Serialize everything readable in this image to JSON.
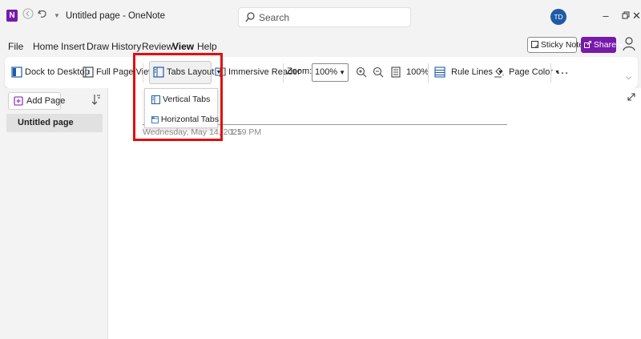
{
  "titlebar": {
    "app_logo": "N",
    "title": "Untitled page  -  OneNote",
    "search_placeholder": "Search",
    "avatar_initials": "TD",
    "icons": [
      "onenote-logo-icon",
      "back-icon",
      "undo-icon",
      "customize-dropdown-icon",
      "minimize-icon",
      "restore-icon",
      "close-icon"
    ]
  },
  "menu": {
    "items": [
      "File",
      "Home",
      "Insert",
      "Draw",
      "History",
      "Review",
      "View",
      "Help"
    ],
    "active": "View",
    "sticky_notes": "Sticky Notes",
    "share": "Share"
  },
  "ribbon": {
    "dock": "Dock to Desktop",
    "full_page": "Full Page View",
    "tabs_layout": "Tabs Layout",
    "immersive": "Immersive Reader",
    "zoom_label": "Zoom:",
    "zoom_value": "100%",
    "zoom_100": "100%",
    "rule_lines": "Rule Lines",
    "page_color": "Page Color",
    "more": "…"
  },
  "dropdown": {
    "items": [
      "Vertical Tabs",
      "Horizontal Tabs"
    ]
  },
  "sidebar": {
    "add_page": "Add Page",
    "pages": [
      "Untitled page"
    ]
  },
  "page": {
    "date": "Wednesday, May 14, 2025",
    "time": "1:19 PM"
  },
  "colors": {
    "brand": "#7719aa",
    "highlight": "#e01010",
    "avatar": "#1f5aa6"
  }
}
